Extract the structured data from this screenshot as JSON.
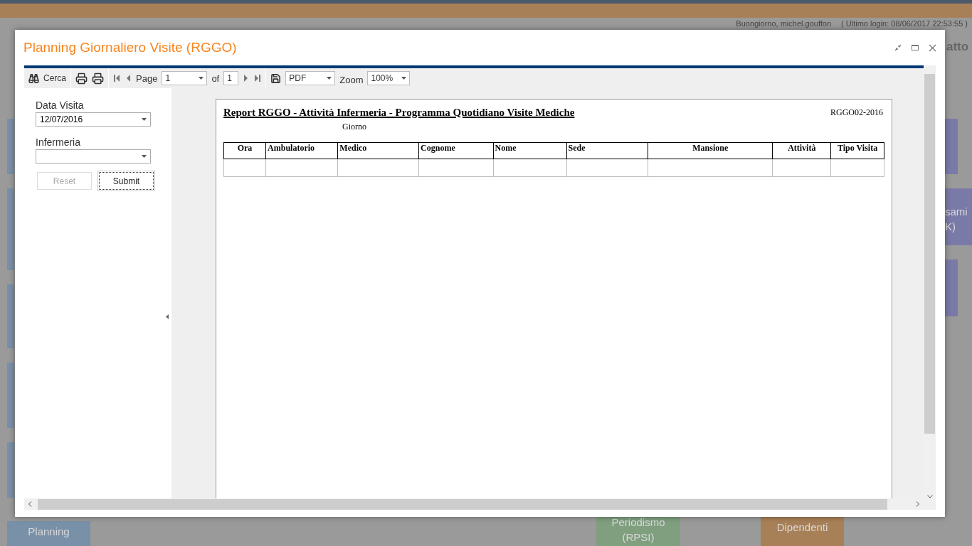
{
  "app": {
    "greeting": "Buongiorno, michel.gouffon",
    "last_login": "( Ultimo login: 08/06/2017 22:53:55 )",
    "header_fragment": "atto",
    "tiles": [
      {
        "kind": "blank",
        "color": "#7890a8"
      },
      {
        "kind": "blank",
        "color": "#7a7aa8",
        "lines": [
          "sami",
          "K)"
        ]
      },
      {
        "kind": "blank",
        "color": "#7890a8",
        "lines": [
          "Planning"
        ]
      },
      {
        "kind": "blank",
        "color": "#7f9f7f",
        "lines": [
          "Periodismo",
          "(RPSI)"
        ]
      },
      {
        "kind": "blank",
        "color": "#a88058",
        "lines": [
          "Dipendenti"
        ]
      }
    ]
  },
  "dialog": {
    "title": "Planning Giornaliero Visite (RGGO)"
  },
  "toolbar": {
    "search": "Cerca",
    "page_label": "Page",
    "page": "1",
    "of_label": "of",
    "page_count": "1",
    "format": "PDF",
    "zoom_label": "Zoom",
    "zoom": "100%"
  },
  "form": {
    "fields": [
      {
        "label": "Data Visita",
        "value": "12/07/2016"
      },
      {
        "label": "Infermeria"
      }
    ],
    "buttons": [
      {
        "label": "Reset",
        "disabled": true,
        "focused": false
      },
      {
        "label": "Submit",
        "disabled": false,
        "focused": true
      }
    ]
  },
  "report": {
    "title": "Report RGGO - Attività Infermeria - Programma Quotidiano Visite Mediche",
    "code": "RGGO02-2016",
    "subtitle": "Giorno",
    "columns": [
      {
        "label": "Ora"
      },
      {
        "label": "Ambulatorio"
      },
      {
        "label": "Medico"
      },
      {
        "label": "Cognome"
      },
      {
        "label": "Nome"
      },
      {
        "label": "Sede"
      },
      {
        "label": "Mansione"
      },
      {
        "label": "Attività"
      },
      {
        "label": "Tipo Visita"
      }
    ]
  }
}
